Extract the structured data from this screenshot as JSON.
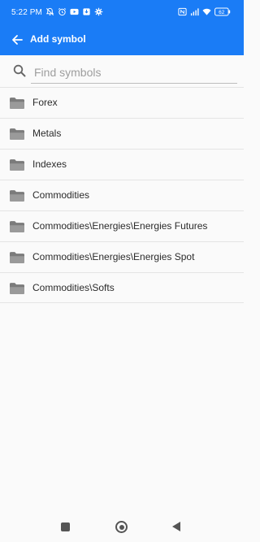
{
  "status_bar": {
    "time": "5:22 PM",
    "left_icons": [
      "mute-bell-icon",
      "alarm-icon",
      "youtube-icon",
      "download-icon",
      "settings-icon"
    ],
    "right_icons": [
      "nfc-icon",
      "signal-4g-icon",
      "wifi-icon",
      "battery-icon"
    ],
    "battery_level": "62"
  },
  "app_bar": {
    "title": "Add symbol",
    "back_icon": "arrow-left-icon",
    "accent_color": "#1a7cf6"
  },
  "search": {
    "placeholder": "Find symbols",
    "value": "",
    "icon": "search-icon"
  },
  "symbol_groups": [
    {
      "label": "Forex",
      "icon": "folder-icon"
    },
    {
      "label": "Metals",
      "icon": "folder-icon"
    },
    {
      "label": "Indexes",
      "icon": "folder-icon"
    },
    {
      "label": "Commodities",
      "icon": "folder-icon"
    },
    {
      "label": "Commodities\\Energies\\Energies Futures",
      "icon": "folder-icon"
    },
    {
      "label": "Commodities\\Energies\\Energies Spot",
      "icon": "folder-icon"
    },
    {
      "label": "Commodities\\Softs",
      "icon": "folder-icon"
    }
  ],
  "nav_bar": {
    "buttons": [
      "recents-square-icon",
      "home-circle-icon",
      "back-triangle-icon"
    ]
  }
}
